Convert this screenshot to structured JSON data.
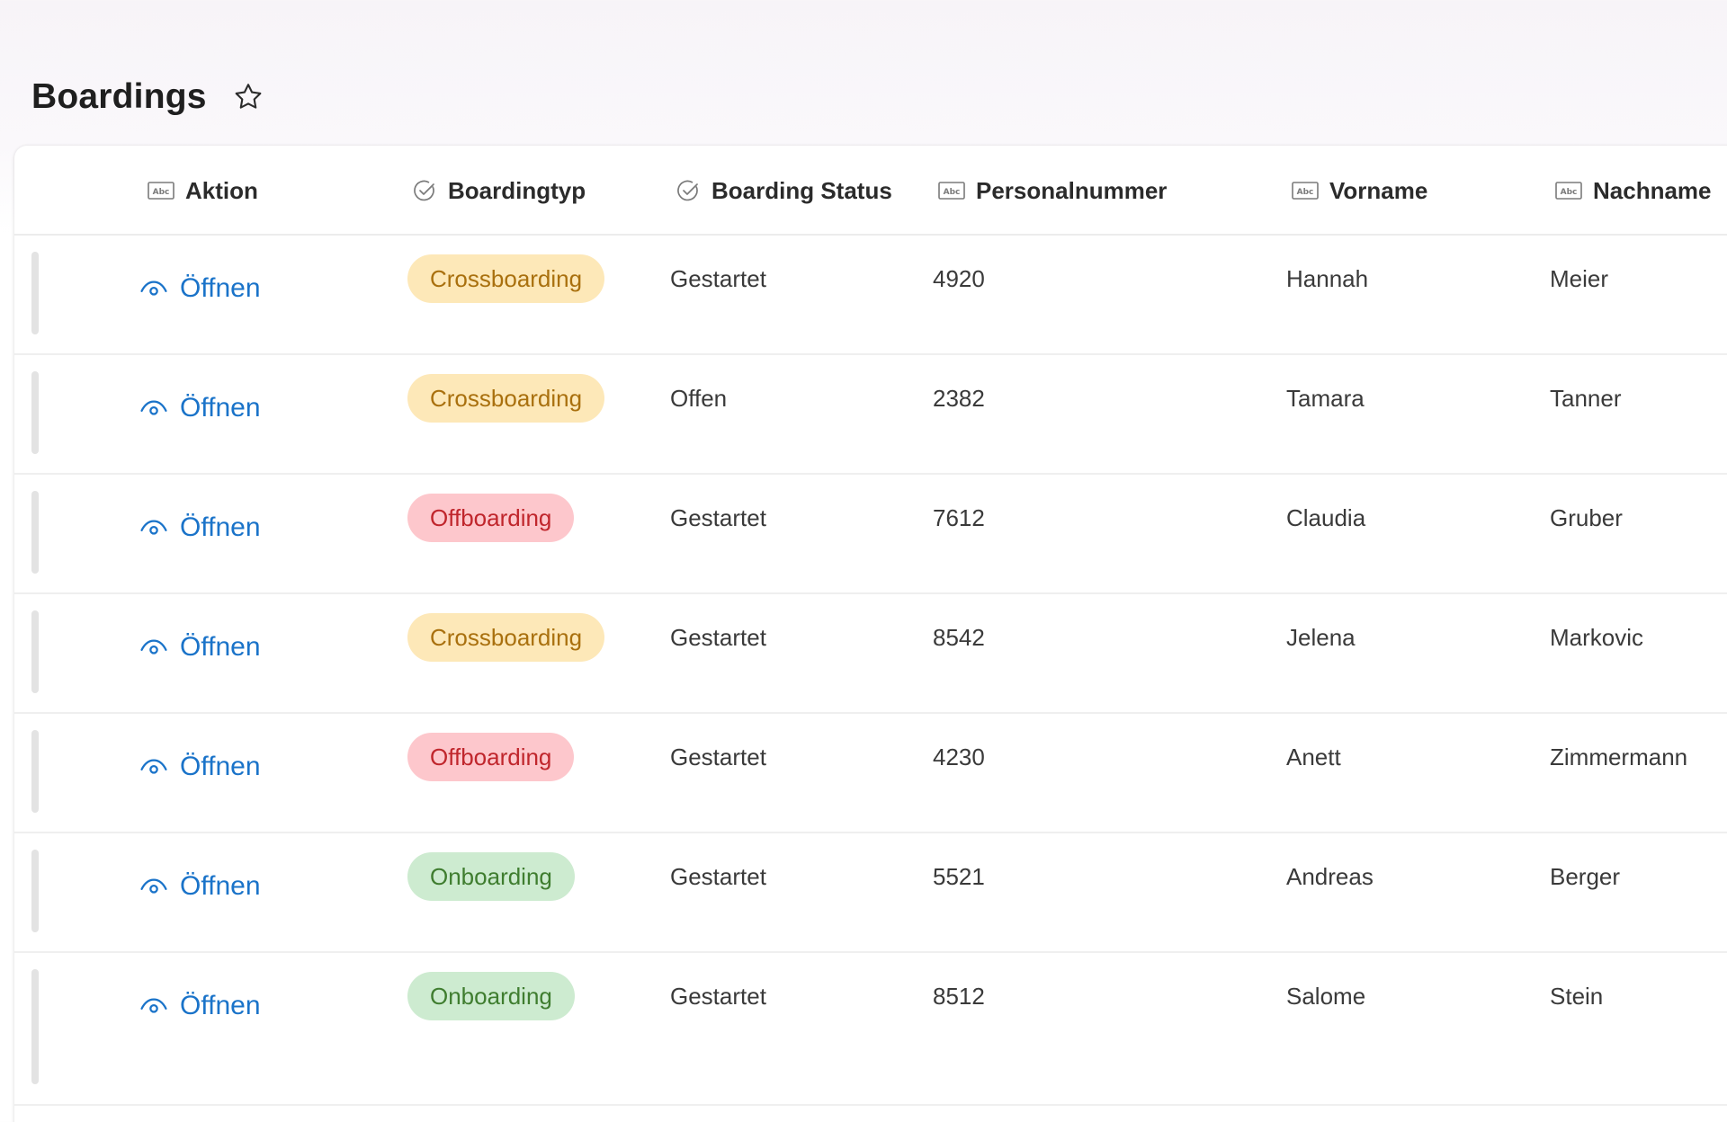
{
  "page": {
    "title": "Boardings"
  },
  "icons": {
    "favorite": "star-icon",
    "text_column": "abc-text-icon",
    "choice_column": "check-circle-icon",
    "view": "eye-icon"
  },
  "columns": {
    "aktion": "Aktion",
    "boardingtyp": "Boardingtyp",
    "status": "Boarding Status",
    "personalnummer": "Personalnummer",
    "vorname": "Vorname",
    "nachname": "Nachname"
  },
  "type_styles": {
    "Crossboarding": {
      "bg": "#fde8b8",
      "fg": "#a9700e"
    },
    "Offboarding": {
      "bg": "#fdc7cc",
      "fg": "#c0262c"
    },
    "Onboarding": {
      "bg": "#cdebd0",
      "fg": "#3f7d2f"
    }
  },
  "colors": {
    "link": "#1a73c9"
  },
  "rows": [
    {
      "action": "Öffnen",
      "type": "Crossboarding",
      "status": "Gestartet",
      "personalnummer": "4920",
      "vorname": "Hannah",
      "nachname": "Meier"
    },
    {
      "action": "Öffnen",
      "type": "Crossboarding",
      "status": "Offen",
      "personalnummer": "2382",
      "vorname": "Tamara",
      "nachname": "Tanner"
    },
    {
      "action": "Öffnen",
      "type": "Offboarding",
      "status": "Gestartet",
      "personalnummer": "7612",
      "vorname": "Claudia",
      "nachname": "Gruber"
    },
    {
      "action": "Öffnen",
      "type": "Crossboarding",
      "status": "Gestartet",
      "personalnummer": "8542",
      "vorname": "Jelena",
      "nachname": "Markovic"
    },
    {
      "action": "Öffnen",
      "type": "Offboarding",
      "status": "Gestartet",
      "personalnummer": "4230",
      "vorname": "Anett",
      "nachname": "Zimmermann"
    },
    {
      "action": "Öffnen",
      "type": "Onboarding",
      "status": "Gestartet",
      "personalnummer": "5521",
      "vorname": "Andreas",
      "nachname": "Berger"
    },
    {
      "action": "Öffnen",
      "type": "Onboarding",
      "status": "Gestartet",
      "personalnummer": "8512",
      "vorname": "Salome",
      "nachname": "Stein"
    }
  ]
}
